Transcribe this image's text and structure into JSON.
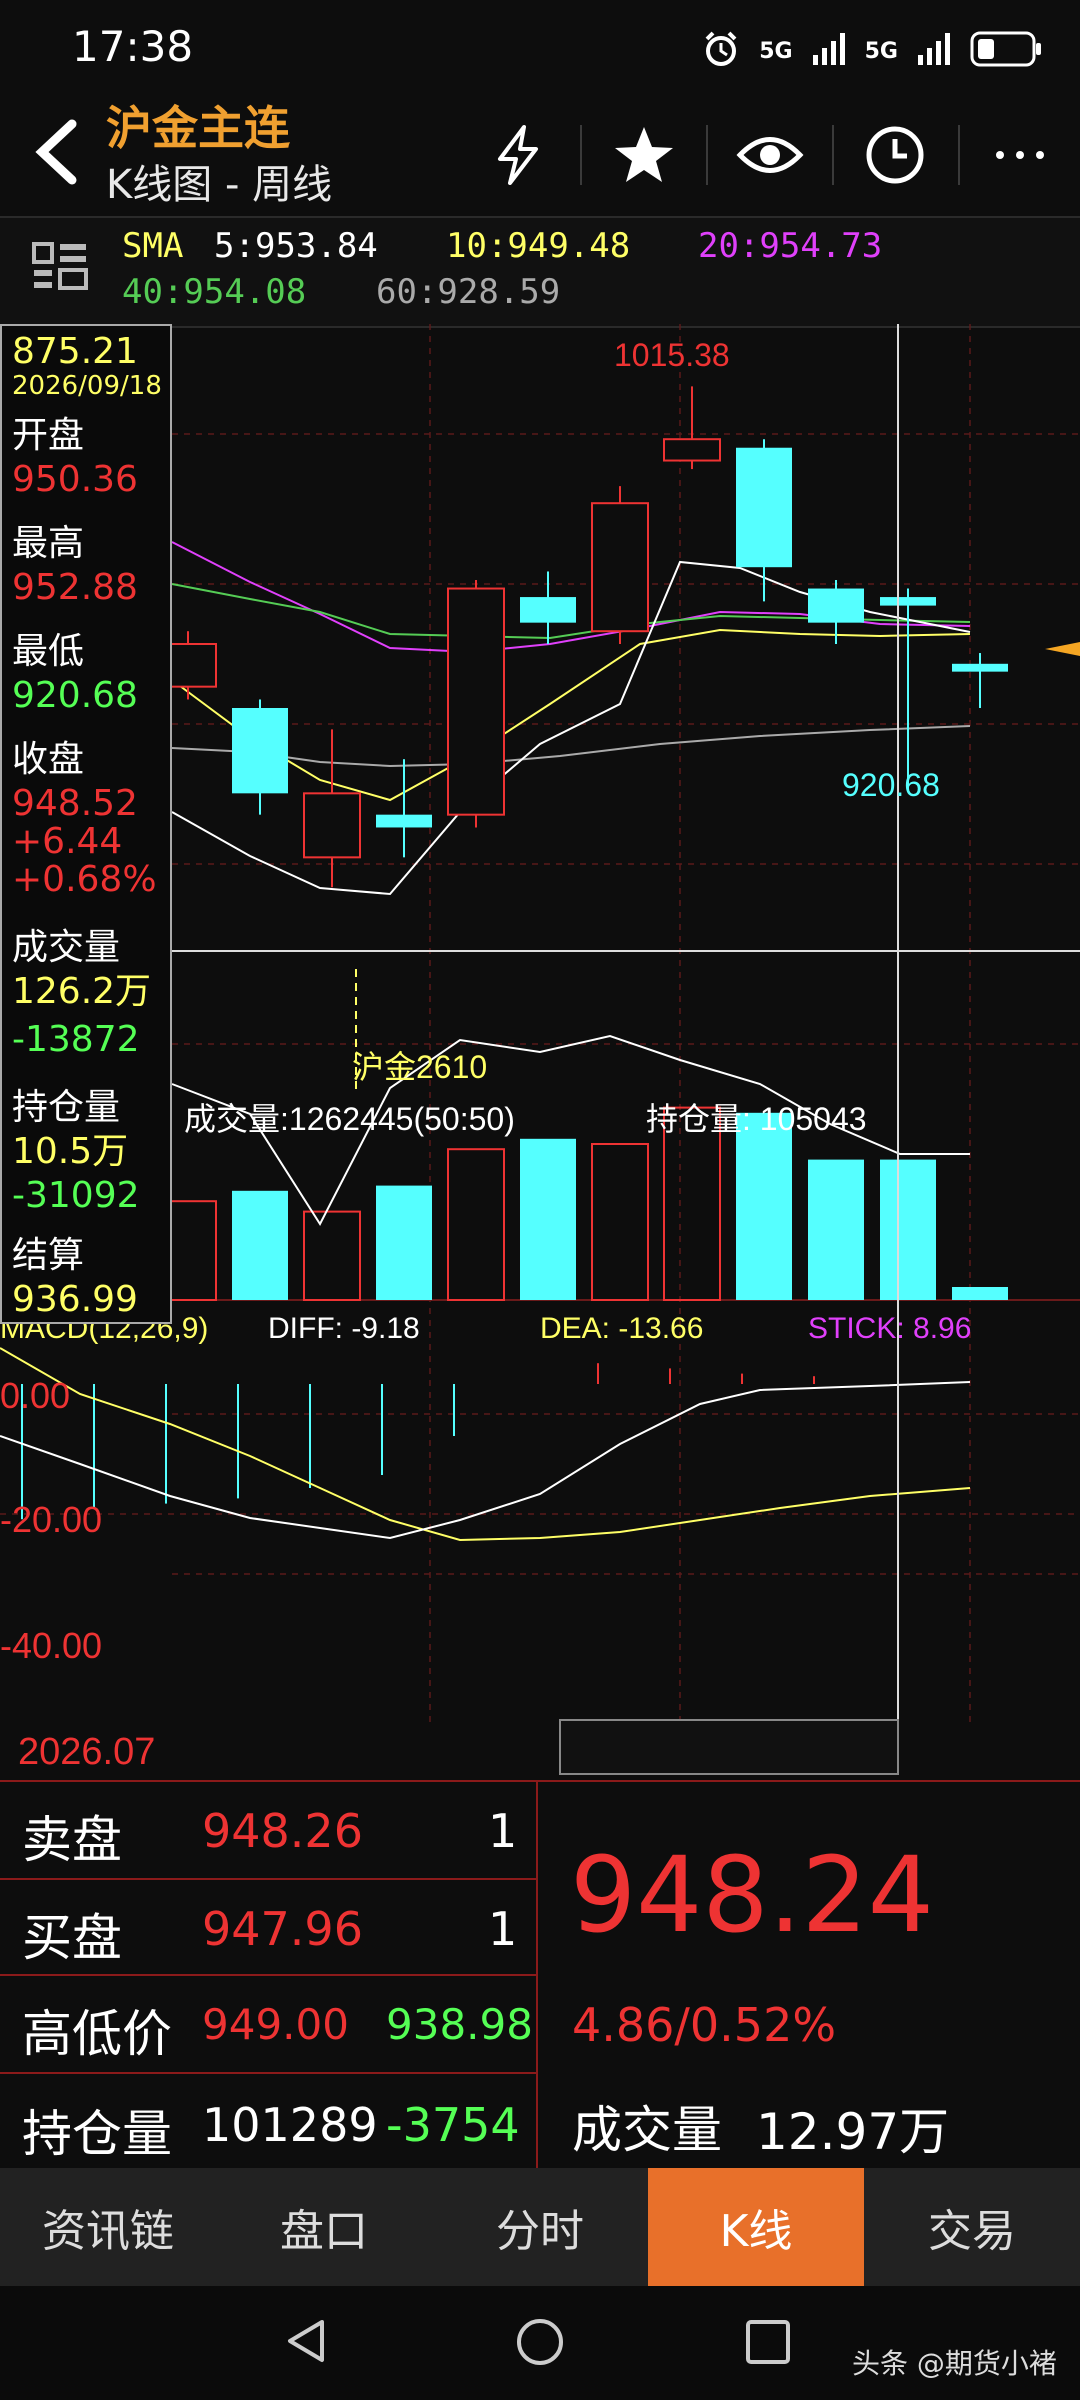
{
  "status": {
    "time": "17:38",
    "net1": "5G",
    "net2": "5G"
  },
  "header": {
    "title": "沪金主连",
    "subtitle": "K线图 - 周线"
  },
  "sma": {
    "label": "SMA",
    "ma5": "5:953.84",
    "ma10": "10:949.48",
    "ma20": "20:954.73",
    "ma40": "40:954.08",
    "ma60": "60:928.59"
  },
  "info": {
    "price": "875.21",
    "date": "2026/09/18",
    "open_label": "开盘",
    "open": "950.36",
    "high_label": "最高",
    "high": "952.88",
    "low_label": "最低",
    "low": "920.68",
    "close_label": "收盘",
    "close": "948.52",
    "chg": "+6.44",
    "chg_pct": "+0.68%",
    "vol_label": "成交量",
    "vol": "126.2万",
    "vol_chg": "-13872",
    "oi_label": "持仓量",
    "oi": "10.5万",
    "oi_chg": "-31092",
    "settle_label": "结算",
    "settle": "936.99"
  },
  "chart": {
    "high_label": "1015.38",
    "low_label": "920.68",
    "contract_label": "沪金2610",
    "volume_label": "成交量:1262445(50:50)",
    "oi_label": "持仓量: 105043",
    "macd_label": "MACD(12,26,9)",
    "diff": "DIFF: -9.18",
    "dea": "DEA: -13.66",
    "stick": "STICK: 8.96",
    "macd_ticks": [
      "0.00",
      "-20.00",
      "-40.00"
    ],
    "date_label": "2026.07"
  },
  "chart_data": {
    "type": "candlestick",
    "candles": [
      {
        "open": 945,
        "close": 955,
        "high": 958,
        "low": 942
      },
      {
        "open": 940,
        "close": 920,
        "high": 942,
        "low": 915
      },
      {
        "open": 905,
        "close": 920,
        "high": 935,
        "low": 898
      },
      {
        "open": 915,
        "close": 912,
        "high": 928,
        "low": 905
      },
      {
        "open": 915,
        "close": 968,
        "high": 970,
        "low": 912
      },
      {
        "open": 966,
        "close": 960,
        "high": 972,
        "low": 955
      },
      {
        "open": 958,
        "close": 988,
        "high": 992,
        "low": 955
      },
      {
        "open": 998,
        "close": 1003,
        "high": 1015.38,
        "low": 996
      },
      {
        "open": 1001,
        "close": 973,
        "high": 1003,
        "low": 965
      },
      {
        "open": 968,
        "close": 960,
        "high": 970,
        "low": 955
      },
      {
        "open": 966,
        "close": 964,
        "high": 968,
        "low": 920.68
      },
      {
        "open": 950.36,
        "close": 948.52,
        "high": 952.88,
        "low": 940
      }
    ],
    "volume": [
      0.38,
      0.42,
      0.34,
      0.44,
      0.58,
      0.62,
      0.6,
      0.74,
      0.72,
      0.54,
      0.54,
      0.05
    ],
    "macd_stick": [
      -52,
      -48,
      -46,
      -44,
      -40,
      -35,
      -20,
      0,
      8,
      6,
      4,
      3
    ]
  },
  "quote": {
    "sell_label": "卖盘",
    "sell_price": "948.26",
    "sell_qty": "1",
    "buy_label": "买盘",
    "buy_price": "947.96",
    "buy_qty": "1",
    "hl_label": "高低价",
    "hl_high": "949.00",
    "hl_low": "938.98",
    "oi_label": "持仓量",
    "oi": "101289",
    "oi_chg": "-3754",
    "last": "948.24",
    "chg": "4.86/0.52%",
    "vol_label": "成交量",
    "vol": "12.97万"
  },
  "tabs": [
    "资讯链",
    "盘口",
    "分时",
    "K线",
    "交易"
  ],
  "watermark": "头条 @期货小褚",
  "colors": {
    "up": "#e33",
    "down": "#5ff",
    "accent": "#e8702a"
  }
}
